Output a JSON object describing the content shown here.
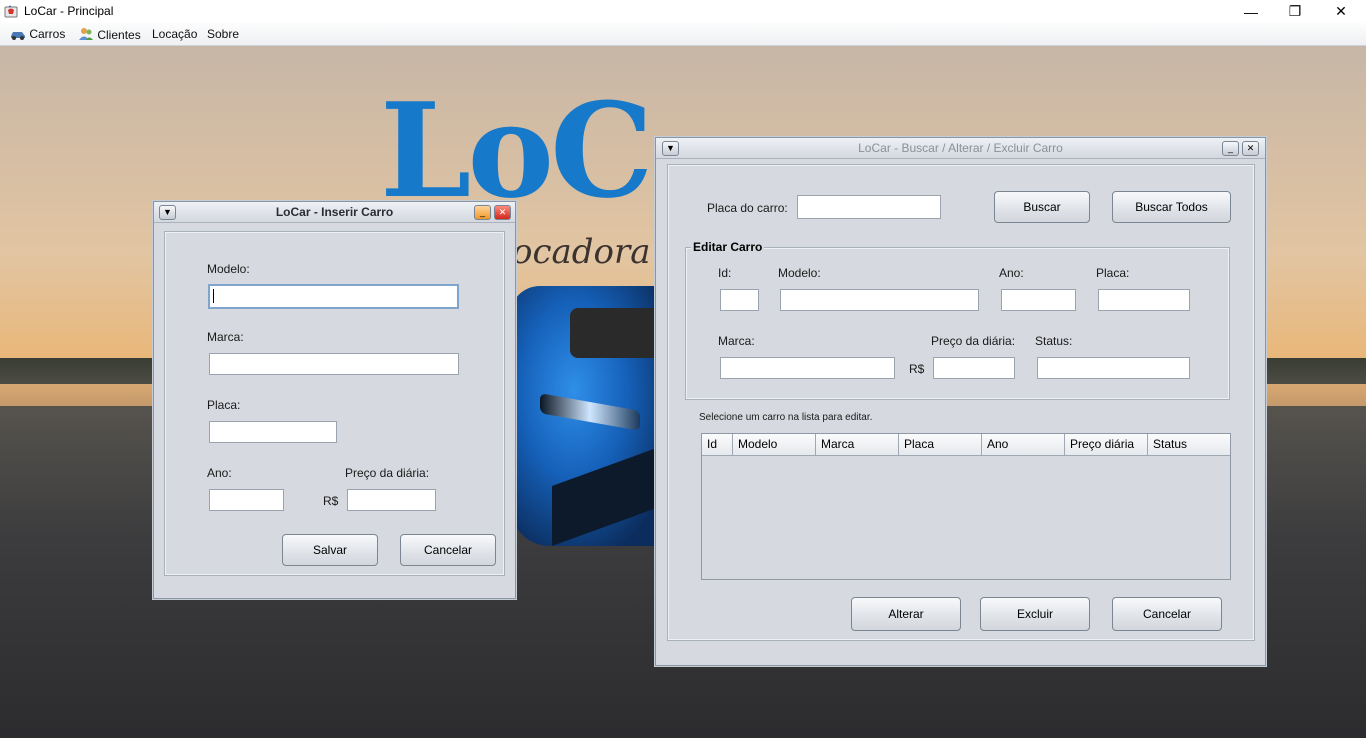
{
  "app": {
    "title": "LoCar - Principal"
  },
  "window_controls": {
    "minimize": "—",
    "restore": "❐",
    "close": "✕"
  },
  "menu": {
    "items": [
      {
        "label": "Carros",
        "icon": "car-icon"
      },
      {
        "label": "Clientes",
        "icon": "users-icon"
      },
      {
        "label": "Locação",
        "icon": ""
      },
      {
        "label": "Sobre",
        "icon": ""
      }
    ]
  },
  "background": {
    "logo_text": "LoC",
    "tagline": "ocadora"
  },
  "insert_dialog": {
    "title": "LoCar - Inserir Carro",
    "modelo_label": "Modelo:",
    "modelo_value": "",
    "marca_label": "Marca:",
    "marca_value": "",
    "placa_label": "Placa:",
    "placa_value": "",
    "ano_label": "Ano:",
    "ano_value": "",
    "preco_label": "Preço da diária:",
    "currency": "R$",
    "preco_value": "",
    "save_label": "Salvar",
    "cancel_label": "Cancelar"
  },
  "search_dialog": {
    "title": "LoCar - Buscar / Alterar / Excluir Carro",
    "placa_label": "Placa do carro:",
    "placa_value": "",
    "buscar_label": "Buscar",
    "buscar_todos_label": "Buscar Todos",
    "edit_group_title": "Editar Carro",
    "id_label": "Id:",
    "modelo_label": "Modelo:",
    "ano_label": "Ano:",
    "placa_field_label": "Placa:",
    "marca_label": "Marca:",
    "preco_label": "Preço da diária:",
    "status_label": "Status:",
    "currency": "R$",
    "hint": "Selecione um carro na lista para editar.",
    "columns": [
      "Id",
      "Modelo",
      "Marca",
      "Placa",
      "Ano",
      "Preço diária",
      "Status"
    ],
    "alterar_label": "Alterar",
    "excluir_label": "Excluir",
    "cancel_label": "Cancelar"
  }
}
